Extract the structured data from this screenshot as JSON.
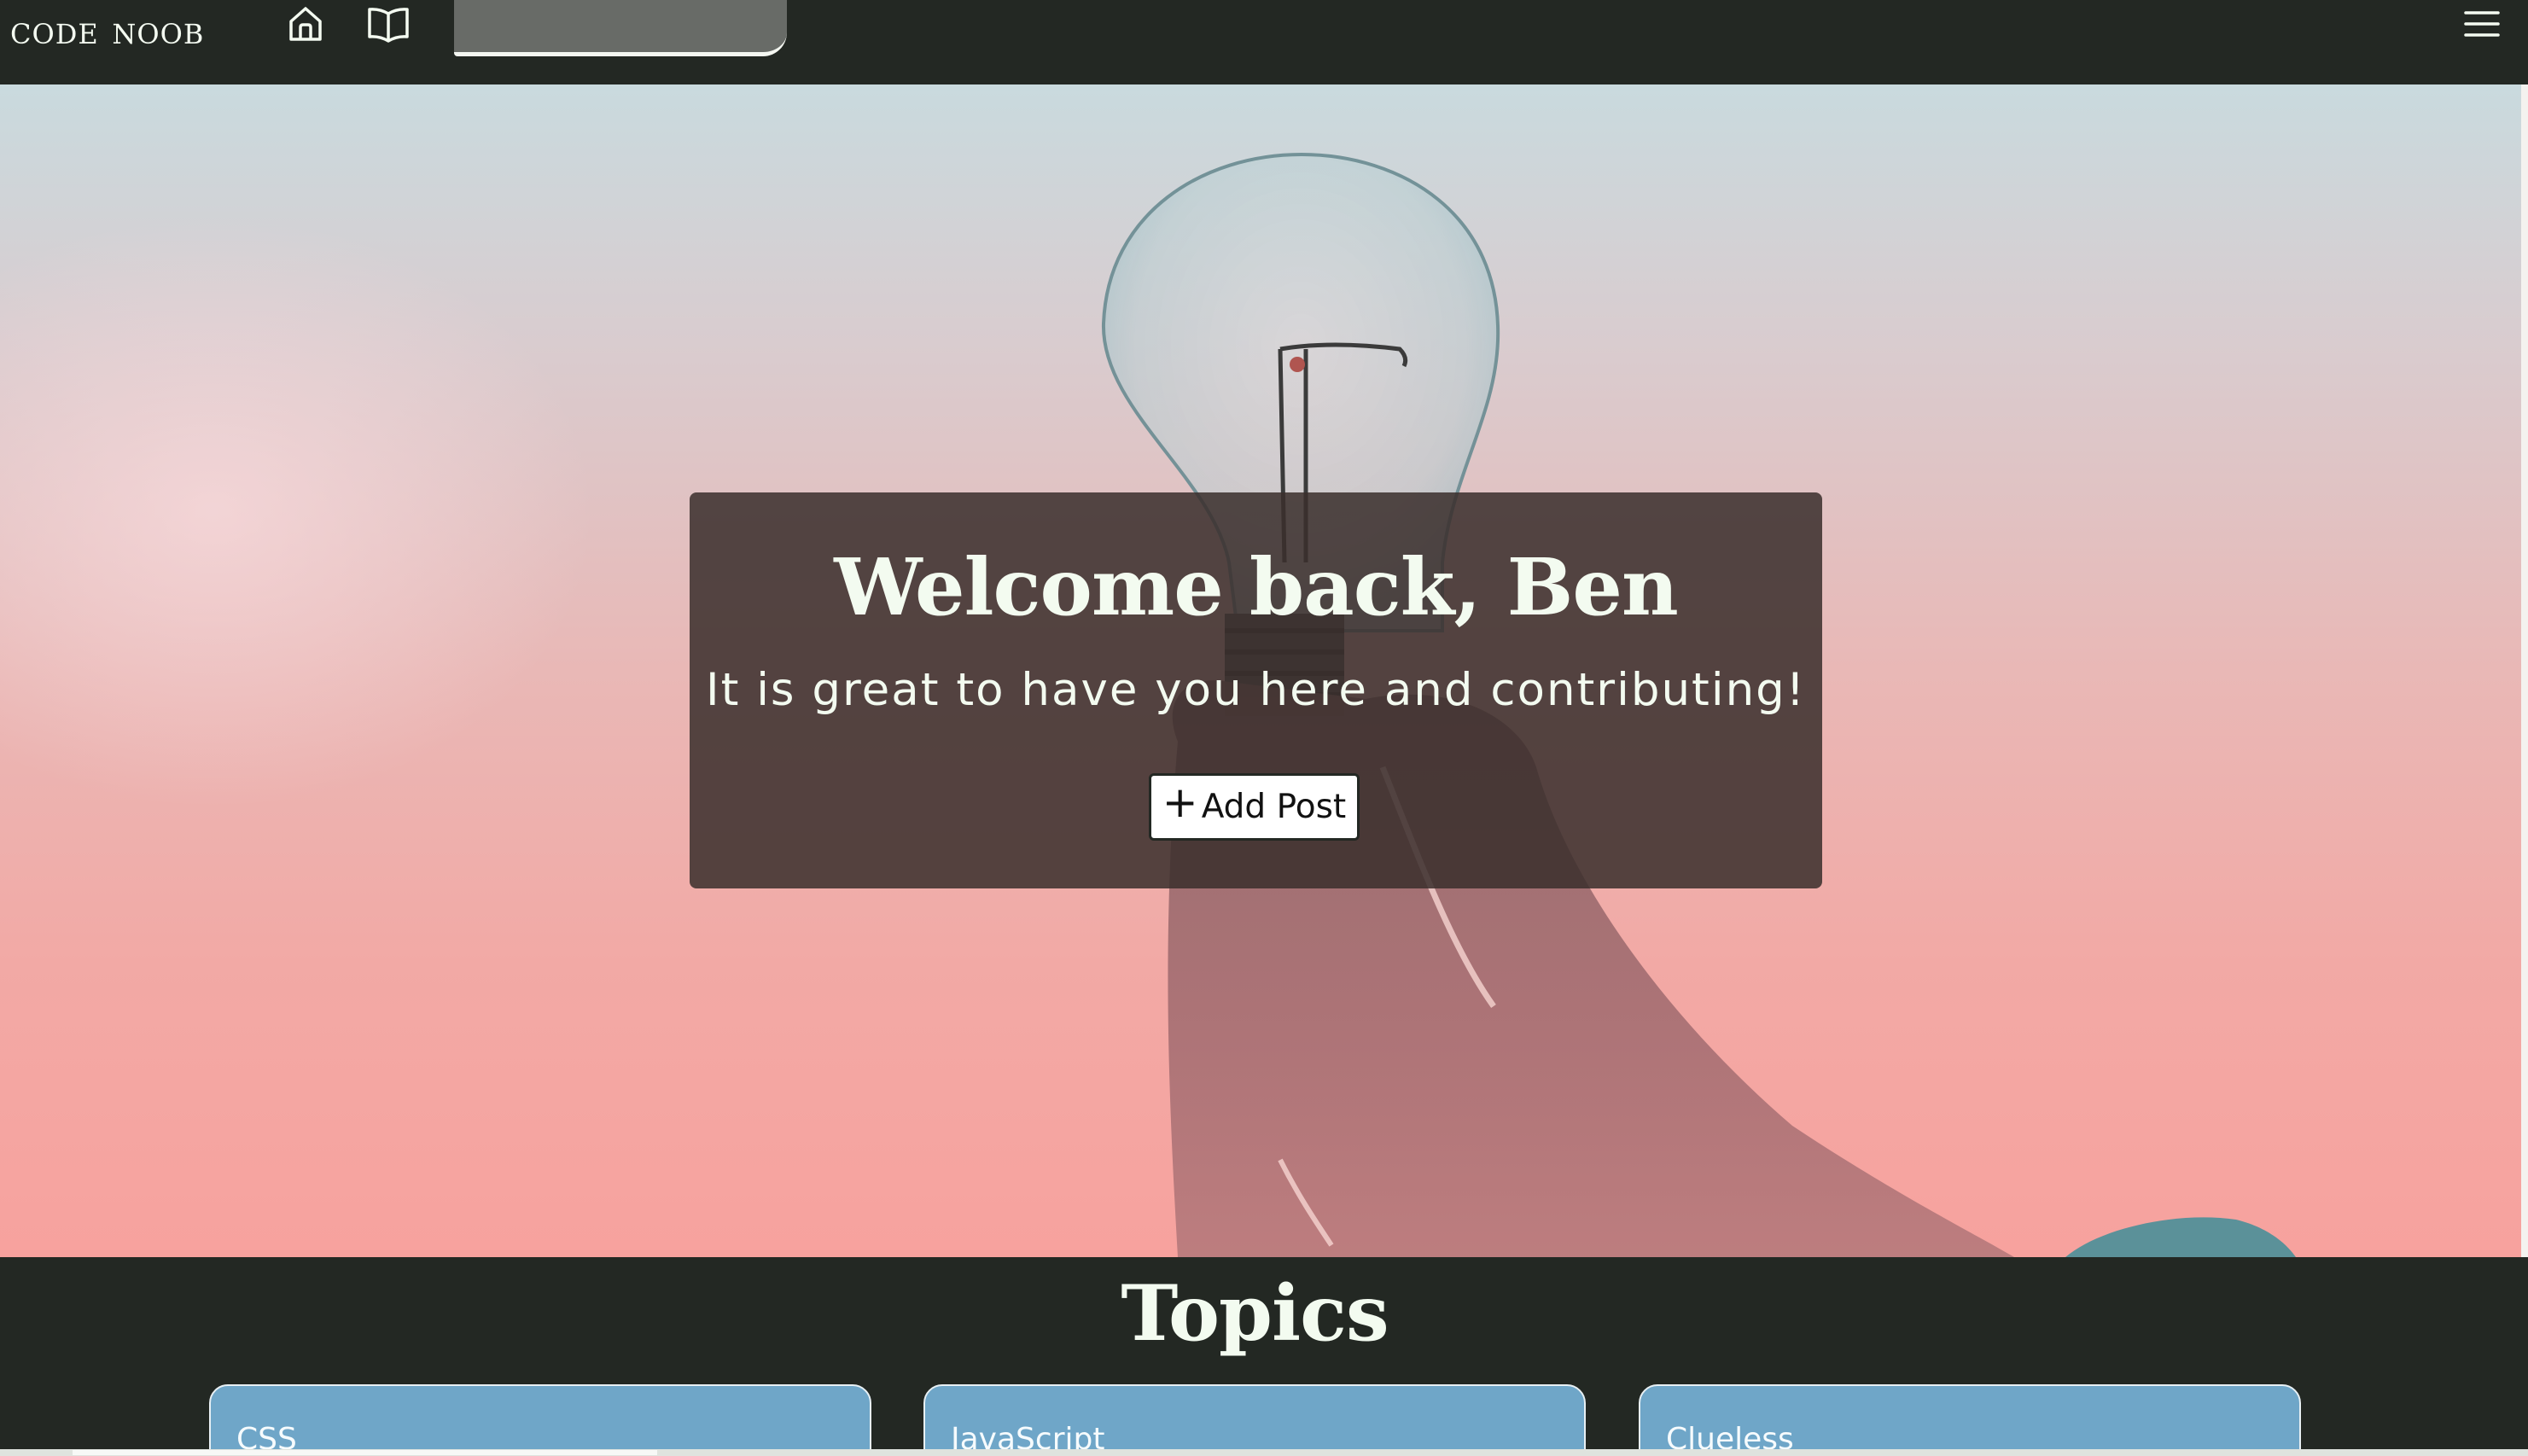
{
  "nav": {
    "brand": "code noob",
    "icons": {
      "home": "home-icon",
      "book": "book-icon",
      "menu": "menu-icon"
    },
    "search_value": ""
  },
  "hero": {
    "title": "Welcome back, Ben",
    "subtitle": "It is great to have you here and contributing!",
    "add_post_icon": "+",
    "add_post_label": "Add Post"
  },
  "topics": {
    "title": "Topics",
    "items": [
      {
        "label": "CSS"
      },
      {
        "label": "JavaScript"
      },
      {
        "label": "Clueless"
      }
    ]
  },
  "colors": {
    "nav_background": "#232823",
    "card_overlay": "#3a2e2c",
    "topic_card": "#6fa6c8",
    "heading_text": "#f3fbf0"
  }
}
